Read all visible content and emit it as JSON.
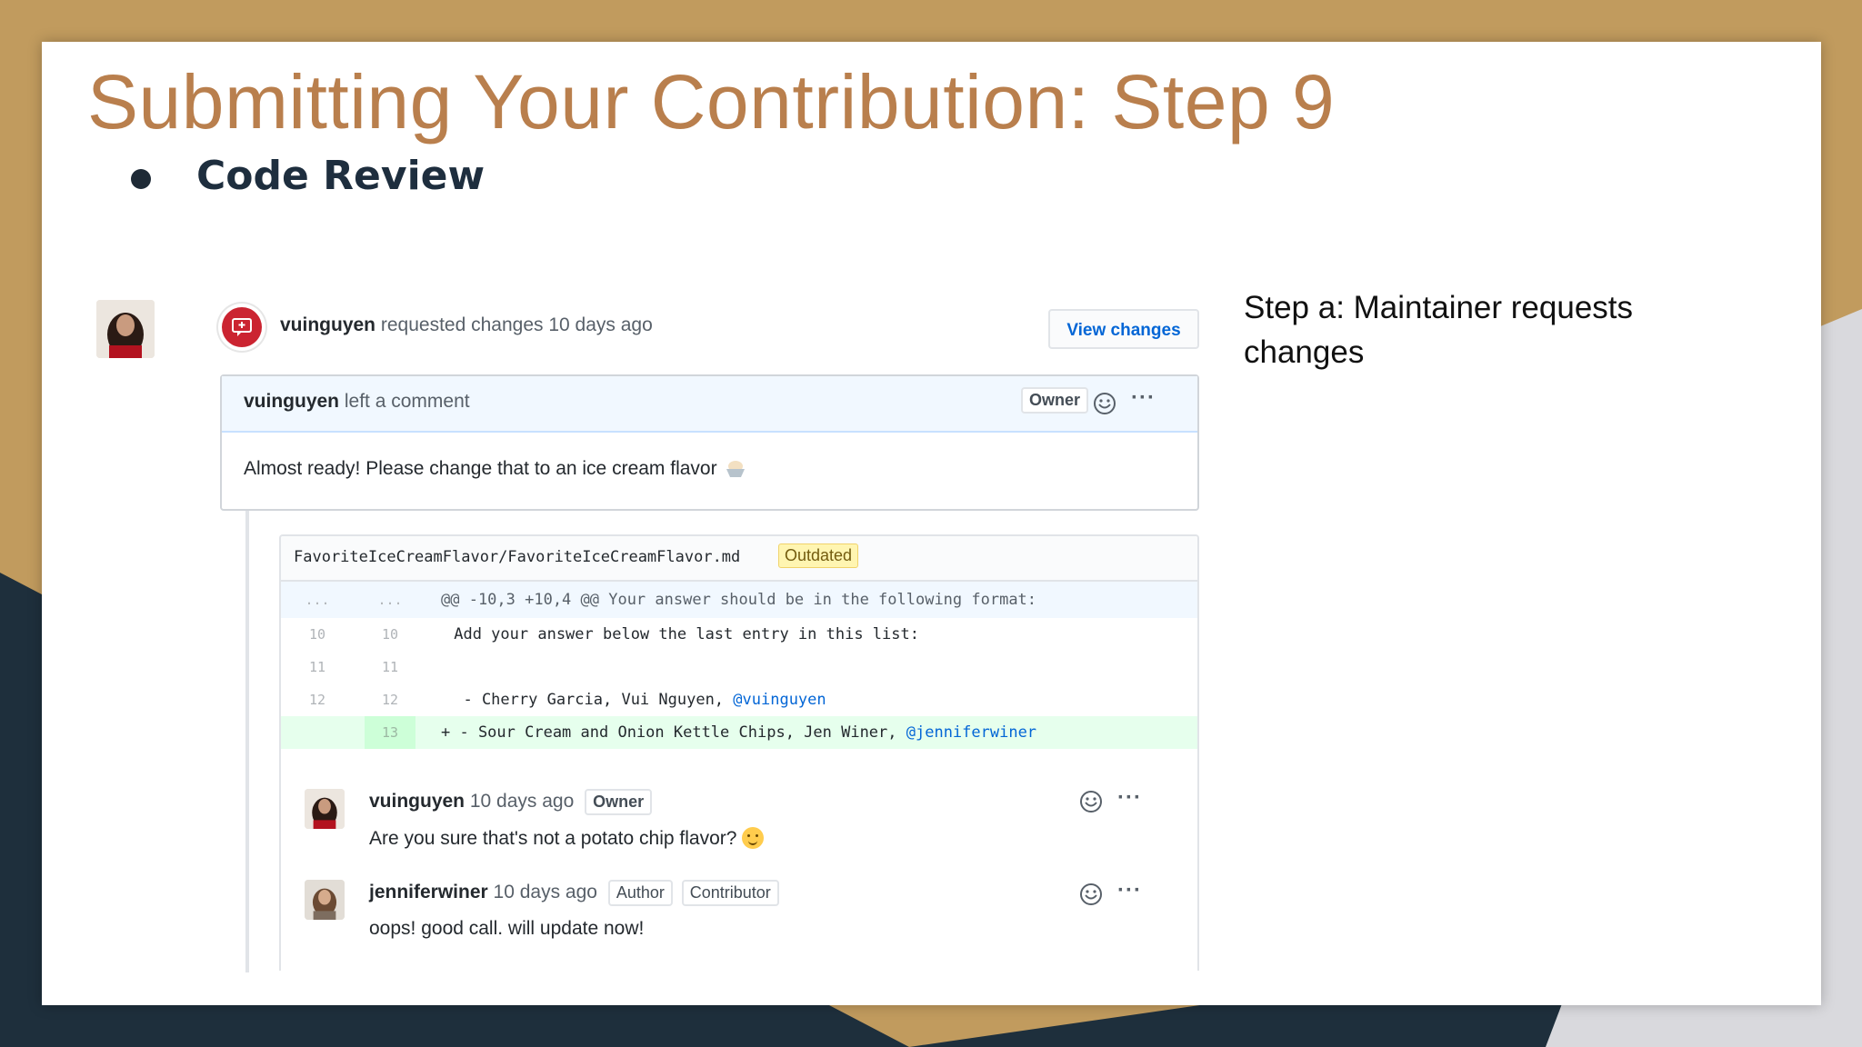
{
  "slide": {
    "title": "Submitting Your Contribution: Step 9",
    "bullet": "Code Review",
    "step_text": "Step a: Maintainer requests changes"
  },
  "github": {
    "event": {
      "user": "vuinguyen",
      "action": "requested changes 10 days ago",
      "view_button": "View changes"
    },
    "top_comment": {
      "user": "vuinguyen",
      "action": "left a comment",
      "label": "Owner",
      "body": "Almost ready! Please change that to an ice cream flavor",
      "reaction_icon": "smiley-reaction-icon",
      "more_icon": "ellipsis-icon"
    },
    "review": {
      "file_path": "FavoriteIceCreamFlavor/FavoriteIceCreamFlavor.md",
      "status": "Outdated",
      "diff": [
        {
          "left": "...",
          "right": "...",
          "code": "@@ -10,3 +10,4 @@ Your answer should be in the following format:",
          "type": "hunk"
        },
        {
          "left": "10",
          "right": "10",
          "code": " Add your answer below the last entry in this list:",
          "type": "context"
        },
        {
          "left": "11",
          "right": "11",
          "code": "",
          "type": "context"
        },
        {
          "left": "12",
          "right": "12",
          "code": "  - Cherry Garcia, Vui Nguyen, ",
          "mention": "@vuinguyen",
          "type": "context"
        },
        {
          "left": "",
          "right": "13",
          "code": "+ - Sour Cream and Onion Kettle Chips, Jen Winer, ",
          "mention": "@jenniferwiner",
          "type": "add"
        }
      ],
      "replies": [
        {
          "user": "vuinguyen",
          "time": "10 days ago",
          "labels": [
            "Owner"
          ],
          "body": "Are you sure that's not a potato chip flavor?"
        },
        {
          "user": "jenniferwiner",
          "time": "10 days ago",
          "labels": [
            "Author",
            "Contributor"
          ],
          "body": "oops! good call. will update now!"
        }
      ]
    }
  },
  "colors": {
    "title": "#b97f4d",
    "frame_gold": "#c19b5e",
    "navy": "#1e2f3c",
    "request_changes_red": "#cb2431",
    "link_blue": "#0366d6",
    "diff_add_bg": "#e6ffed",
    "outdated_bg": "#fff5b1"
  }
}
